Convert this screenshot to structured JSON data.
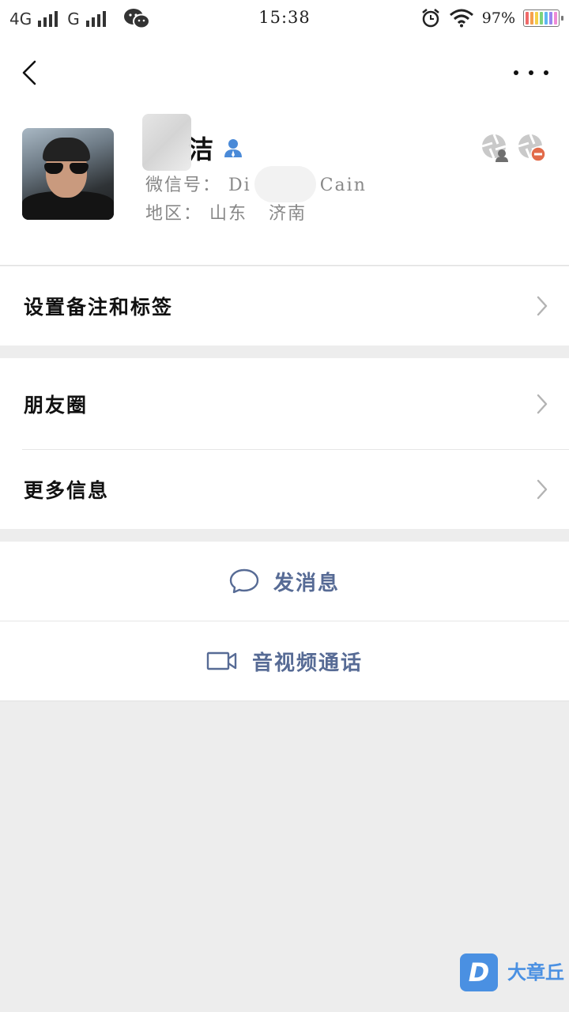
{
  "status_bar": {
    "network1": "4G",
    "network2": "G",
    "time": "15:38",
    "battery_percent": "97%",
    "battery_level": 0.97
  },
  "nav": {
    "back_icon": "chevron-left-icon",
    "more_icon": "more-dots-icon"
  },
  "profile": {
    "name_visible": "洁",
    "wechat_id_label": "微信号：",
    "wechat_id_value": "Di",
    "wechat_id_suffix": "Cain",
    "region_label": "地区：",
    "region_province": "山东",
    "region_city": "济南",
    "gender_icon": "user-icon"
  },
  "menu": {
    "remark_tags": "设置备注和标签",
    "moments": "朋友圈",
    "more_info": "更多信息"
  },
  "actions": {
    "send_message": "发消息",
    "voice_video_call": "音视频通话"
  },
  "watermark": {
    "brand": "大章丘"
  },
  "colors": {
    "link_blue": "#576b95",
    "background": "#ededed",
    "card": "#ffffff"
  }
}
